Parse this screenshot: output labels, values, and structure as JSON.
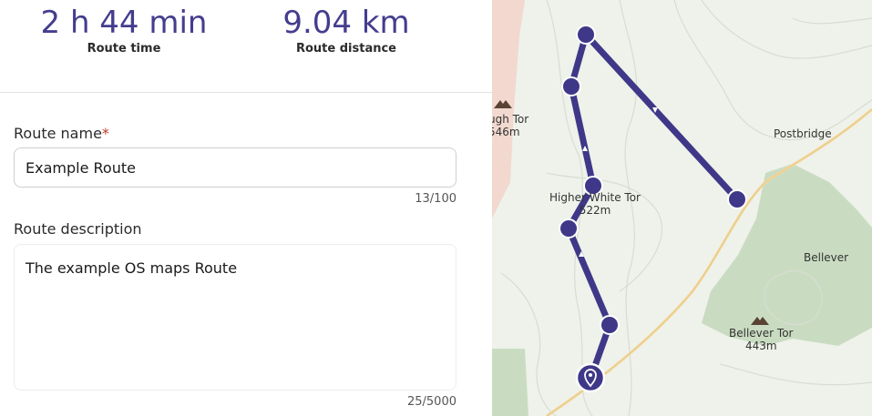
{
  "stats": {
    "route_time": "2 h 44 min",
    "route_time_label": "Route time",
    "route_distance": "9.04 km",
    "route_distance_label": "Route distance"
  },
  "form": {
    "name_label": "Route name",
    "name_required_mark": "*",
    "name_value": "Example Route",
    "name_counter": "13/100",
    "description_label": "Route description",
    "description_value": "The example OS maps Route",
    "description_counter": "25/5000"
  },
  "map": {
    "labels": {
      "tor_left_name": "ugh Tor",
      "tor_left_height": "546m",
      "postbridge": "Postbridge",
      "higher_white_tor_name": "Higher White Tor",
      "higher_white_tor_height": "522m",
      "bellever": "Bellever",
      "bellever_tor_name": "Bellever Tor",
      "bellever_tor_height": "443m"
    },
    "icons": {
      "tor": "tor-summit-icon",
      "start_marker": "location-pin-icon",
      "waypoint": "waypoint-dot"
    },
    "colors": {
      "route": "#3f3888",
      "background": "#eef2ea",
      "forest": "#c9dcc2",
      "contour": "#d8ddd3",
      "road": "#f3d9a0",
      "moorland_edge": "#f2d5cc"
    }
  }
}
